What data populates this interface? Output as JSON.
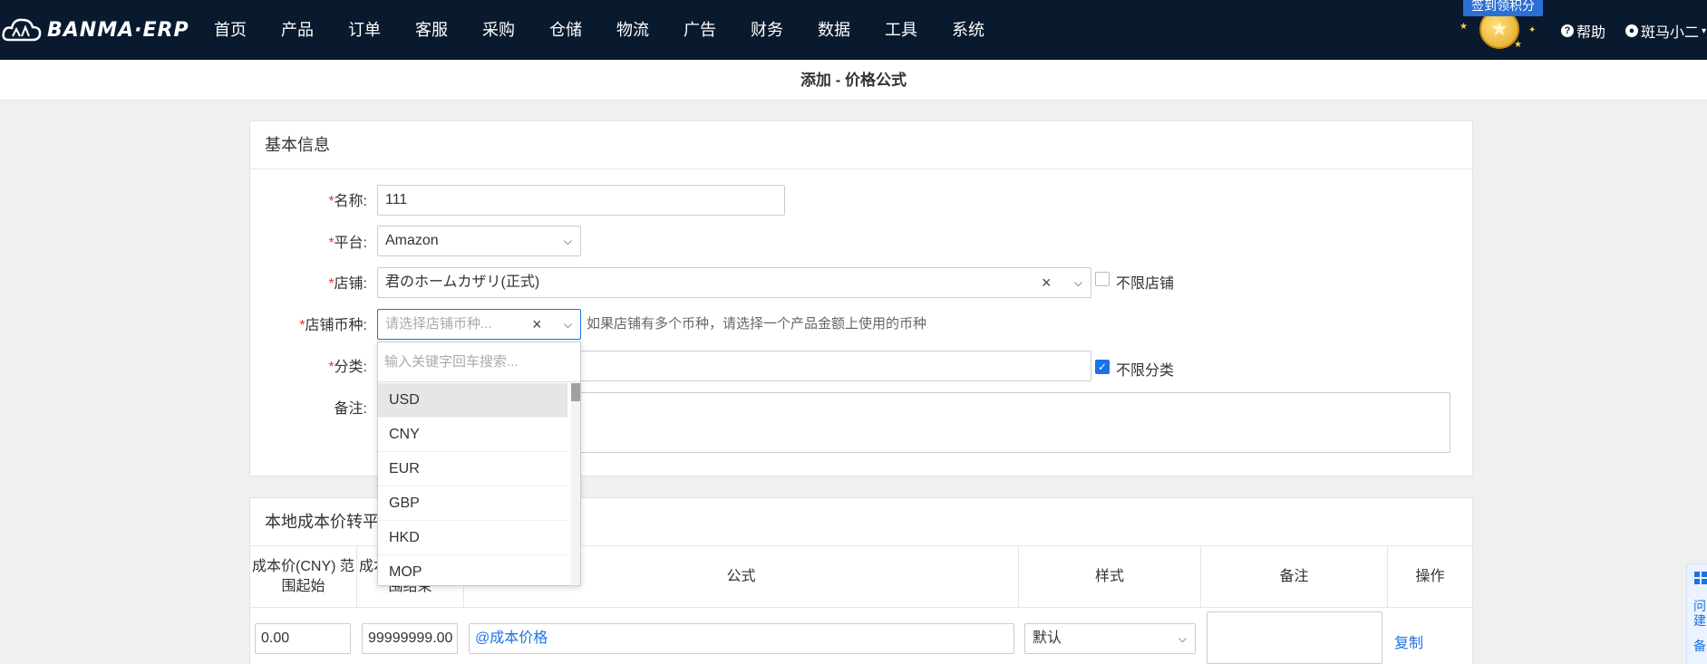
{
  "nav": {
    "logo_text": "BANMA·ERP",
    "menu": [
      "首页",
      "产品",
      "订单",
      "客服",
      "采购",
      "仓储",
      "物流",
      "广告",
      "财务",
      "数据",
      "工具",
      "系统"
    ],
    "badge": "签到领积分",
    "help": "帮助",
    "user": "斑马小二"
  },
  "page": {
    "title": "添加 - 价格公式"
  },
  "basic": {
    "heading": "基本信息",
    "name_label": "名称:",
    "name_value": "111",
    "platform_label": "平台:",
    "platform_value": "Amazon",
    "shop_label": "店铺:",
    "shop_value": "君のホームカザリ(正式)",
    "shop_unlimited": "不限店铺",
    "currency_label": "店铺币种:",
    "currency_placeholder": "请选择店铺币种...",
    "currency_hint": "如果店铺有多个币种，请选择一个产品金额上使用的币种",
    "category_label": "分类:",
    "category_unlimited": "不限分类",
    "remark_label": "备注:"
  },
  "dropdown": {
    "search_placeholder": "输入关键字回车搜索...",
    "options": [
      "USD",
      "CNY",
      "EUR",
      "GBP",
      "HKD",
      "MOP"
    ],
    "highlighted": "USD"
  },
  "table": {
    "heading": "本地成本价转平台",
    "headers": {
      "start": "成本价(CNY) 范围起始",
      "end": "成本价(CNY) 范围结束",
      "formula": "公式",
      "style": "样式",
      "remark": "备注",
      "ops": "操作"
    },
    "row": {
      "start": "0.00",
      "end": "99999999.00",
      "formula": "@成本价格",
      "style": "默认",
      "op": "复制"
    }
  },
  "widget": {
    "line1": "问建",
    "line2": "备"
  },
  "colors": {
    "nav_bg": "#0a1a2e",
    "accent": "#1a73e8",
    "required": "#e33333"
  }
}
